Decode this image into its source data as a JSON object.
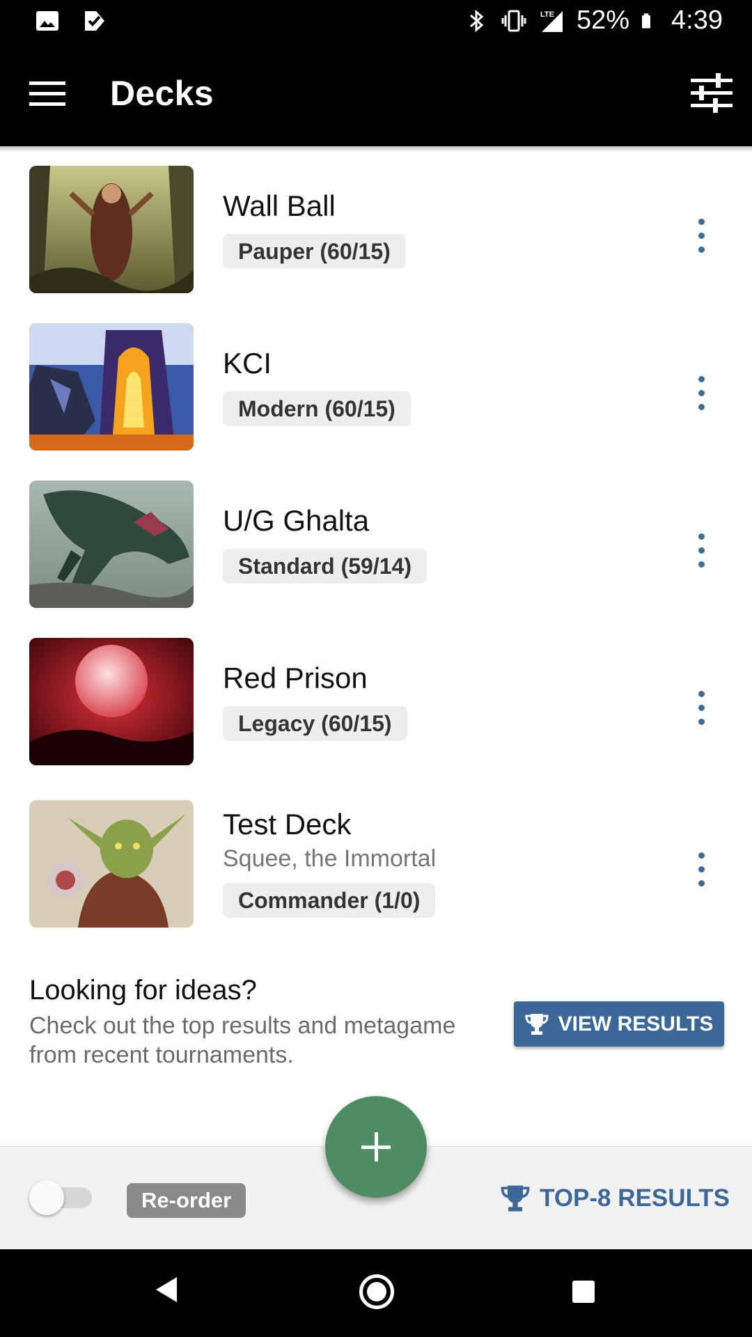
{
  "status_bar": {
    "battery": "52%",
    "time": "4:39",
    "network": "LTE",
    "left_icons": [
      "image-icon",
      "checkmark-notification-icon"
    ],
    "right_icons": [
      "bluetooth-icon",
      "vibrate-icon",
      "signal-icon",
      "battery-icon"
    ]
  },
  "app_bar": {
    "title": "Decks",
    "menu_icon": "hamburger-menu-icon",
    "filter_icon": "sliders-filter-icon"
  },
  "decks": [
    {
      "name": "Wall Ball",
      "subtitle": "",
      "format": "Pauper (60/15)",
      "art": "forest-wizard-art"
    },
    {
      "name": "KCI",
      "subtitle": "",
      "format": "Modern (60/15)",
      "art": "forge-creature-art"
    },
    {
      "name": "U/G Ghalta",
      "subtitle": "",
      "format": "Standard (59/14)",
      "art": "dinosaur-art"
    },
    {
      "name": "Red Prison",
      "subtitle": "",
      "format": "Legacy (60/15)",
      "art": "blood-moon-art"
    },
    {
      "name": "Test Deck",
      "subtitle": "Squee, the Immortal",
      "format": "Commander (1/0)",
      "art": "goblin-art"
    }
  ],
  "ideas": {
    "heading": "Looking for ideas?",
    "body": "Check out the top results and metagame from recent tournaments.",
    "button_label": "VIEW RESULTS"
  },
  "bottom_bar": {
    "reorder_label": "Re-order",
    "reorder_enabled": false,
    "top8_label": "TOP-8 RESULTS"
  },
  "colors": {
    "accent_blue": "#3b6896",
    "fab_green": "#4e8d64",
    "app_bar": "#000000"
  }
}
